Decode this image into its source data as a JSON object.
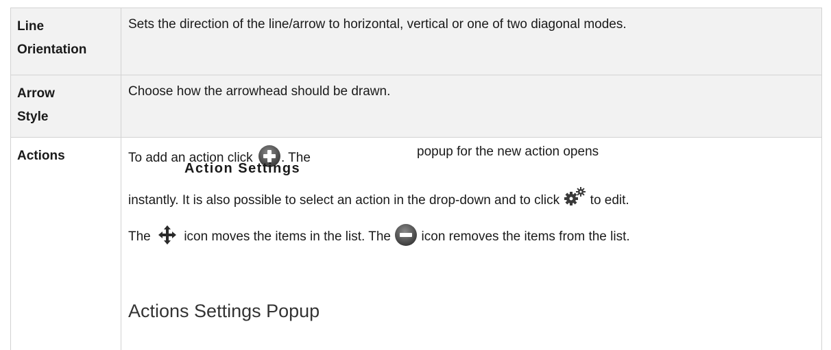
{
  "rows": [
    {
      "term_line1": "Line",
      "term_line2": "Orientation",
      "description": "Sets the direction of the line/arrow to horizontal, vertical or one of two diagonal modes."
    },
    {
      "term_line1": "Arrow",
      "term_line2": "Style",
      "description": "Choose how the arrowhead should be drawn."
    },
    {
      "term": "Actions",
      "line1_a": "To add an action click",
      "line1_b": ". The",
      "line1_bold": "Action Settings",
      "line1_c": "popup for the new action opens",
      "line2_a": "instantly. It is also possible to select an action in the drop-down and to click",
      "line2_b": "to edit.",
      "line3_a": "The",
      "line3_b": "icon moves the items in the list. The",
      "line3_c": "icon removes the items from the list.",
      "heading": "Actions Settings Popup"
    }
  ],
  "icons": {
    "add": "add-circle-icon",
    "settings": "gears-icon",
    "move": "move-arrows-icon",
    "remove": "remove-circle-icon"
  }
}
